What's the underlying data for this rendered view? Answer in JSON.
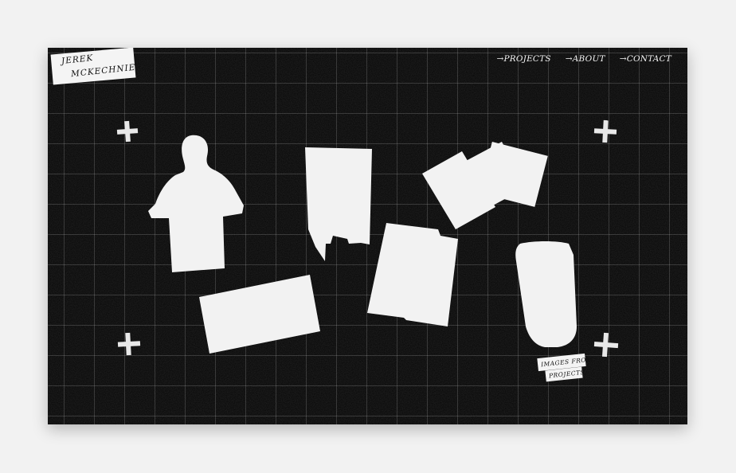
{
  "logo": {
    "line1": "JEREK",
    "line2": "MCKECHNIE"
  },
  "nav": {
    "items": [
      {
        "label": "→PROJECTS"
      },
      {
        "label": "→ABOUT"
      },
      {
        "label": "→CONTACT"
      }
    ]
  },
  "caption": {
    "line1": "IMAGES FROM",
    "line2": "PROJECTS."
  },
  "colors": {
    "background": "#050505",
    "paper": "#f4f4f4",
    "page": "#f2f2f2"
  }
}
